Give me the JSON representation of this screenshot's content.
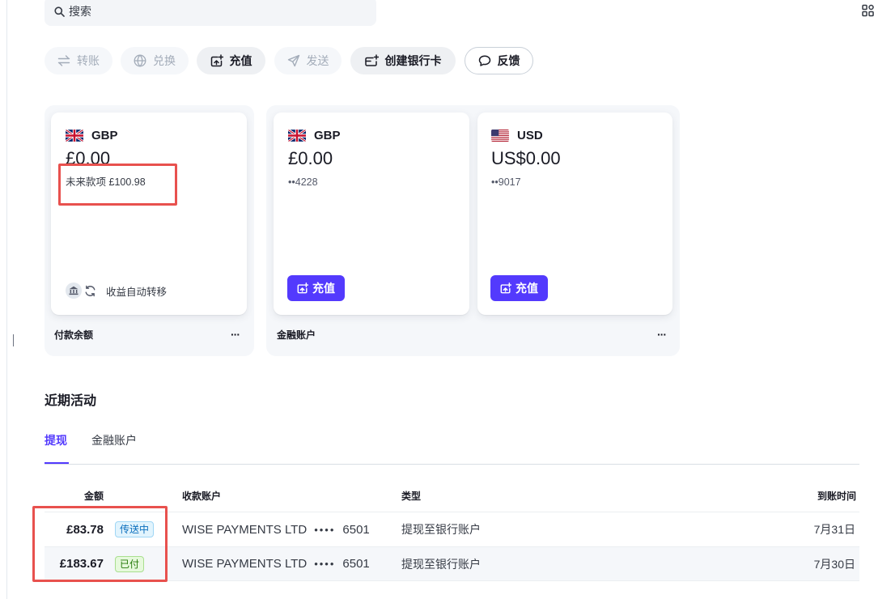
{
  "search": {
    "placeholder": "搜索",
    "icon": "search-icon"
  },
  "header": {
    "apps_icon": "apps-grid-icon"
  },
  "actions": [
    {
      "label": "转账",
      "icon": "transfer-icon",
      "disabled": true
    },
    {
      "label": "兑换",
      "icon": "globe-icon",
      "disabled": true
    },
    {
      "label": "充值",
      "icon": "add-funds-icon",
      "disabled": false
    },
    {
      "label": "发送",
      "icon": "send-icon",
      "disabled": true
    },
    {
      "label": "创建银行卡",
      "icon": "card-plus-icon",
      "disabled": false
    },
    {
      "label": "反馈",
      "icon": "chat-bubble-icon",
      "disabled": false
    }
  ],
  "payments_balance": {
    "label": "付款余额",
    "more": "···",
    "card": {
      "currency": "GBP",
      "flag": "uk-flag-icon",
      "amount": "£0.00",
      "future_label": "未来款项",
      "future_amount": "£100.98",
      "auto_transfer_label": "收益自动转移",
      "auto_transfer_icons": [
        "bank-icon",
        "refresh-icon"
      ]
    }
  },
  "financial_accounts": {
    "label": "金融账户",
    "more": "···",
    "cards": [
      {
        "currency": "GBP",
        "flag": "uk-flag-icon",
        "amount": "£0.00",
        "account": "••4228",
        "topup_label": "充值",
        "topup_icon": "add-funds-icon"
      },
      {
        "currency": "USD",
        "flag": "us-flag-icon",
        "amount": "US$0.00",
        "account": "••9017",
        "topup_label": "充值",
        "topup_icon": "add-funds-icon"
      }
    ]
  },
  "recent_activity": {
    "title": "近期活动",
    "tabs": [
      {
        "label": "提现",
        "active": true
      },
      {
        "label": "金融账户",
        "active": false
      }
    ],
    "columns": {
      "amount": "金额",
      "account": "收款账户",
      "type": "类型",
      "arrival": "到账时间"
    },
    "rows": [
      {
        "amount": "£83.78",
        "status": "传送中",
        "account_name": "WISE PAYMENTS LTD",
        "account_mask": "••••",
        "account_last4": "6501",
        "type": "提现至银行账户",
        "arrival": "7月31日"
      },
      {
        "amount": "£183.67",
        "status": "已付",
        "account_name": "WISE PAYMENTS LTD",
        "account_mask": "••••",
        "account_last4": "6501",
        "type": "提现至银行账户",
        "arrival": "7月30日"
      }
    ]
  },
  "colors": {
    "accent": "#533afd",
    "text": "#1a1b25",
    "body": "#353a44",
    "muted": "#a3acb9",
    "pending_text": "#0a6ebd",
    "pending_bg": "#e2f4fd",
    "pending_border": "#9fd6f5",
    "paid_text": "#257a09",
    "paid_bg": "#e6f9dc",
    "paid_border": "#a9df8f",
    "highlight": "#e8514e"
  }
}
